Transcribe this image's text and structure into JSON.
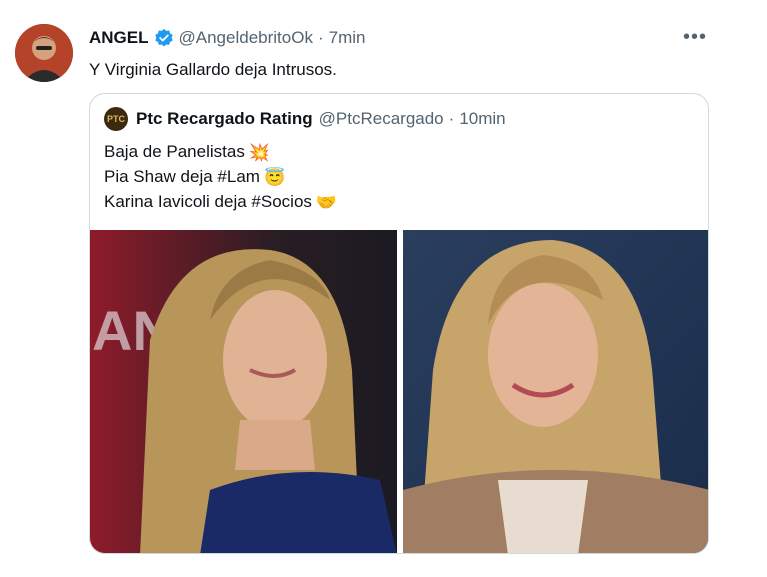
{
  "tweet": {
    "author_name": "ANGEL",
    "handle": "@AngeldebritoOk",
    "separator": "·",
    "time": "7min",
    "text": "Y Virginia Gallardo deja Intrusos.",
    "more_icon": "more-icon",
    "verified_color": "#1d9bf0"
  },
  "quoted": {
    "author_name": "Ptc Recargado Rating",
    "handle": "@PtcRecargado",
    "separator": "·",
    "time": "10min",
    "lines": [
      {
        "text": "Baja de Panelistas",
        "emoji": "💥"
      },
      {
        "text": "Pia Shaw deja #Lam",
        "emoji": "😇"
      },
      {
        "text": "Karina Iavicoli deja #Socios",
        "emoji": "🤝"
      }
    ],
    "avatar_text": "PTC"
  },
  "colors": {
    "secondary_text": "#536471",
    "border": "#cfd9de"
  }
}
